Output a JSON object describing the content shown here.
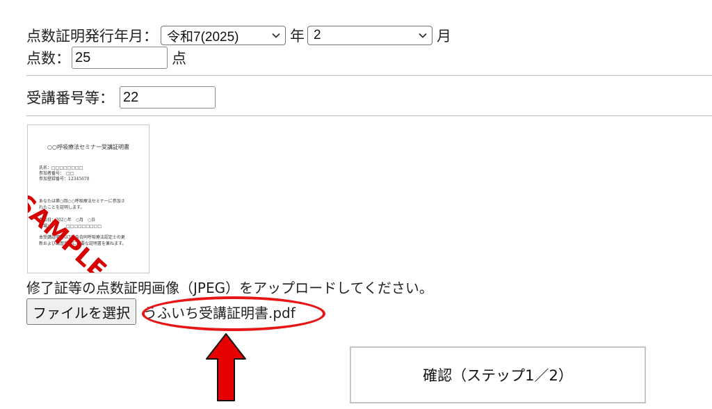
{
  "form": {
    "issue_date_label": "点数証明発行年月：",
    "year_selected": "令和7(2025)",
    "year_unit": "年",
    "month_selected": "2",
    "month_unit": "月",
    "score_label": "点数：",
    "score_value": "25",
    "score_unit": "点",
    "attendee_number_label": "受講番号等：",
    "attendee_number_value": "22"
  },
  "sample_image": {
    "title": "○○呼吸療法セミナー受講証明書",
    "lines": [
      "氏名：□□□□□□□□",
      "参加者番号：　□□",
      "参加登録番号：12345678",
      "あなたは第○回○○呼吸療法セミナーに参加さ",
      "れたことを証明します。",
      "参加日：202○年　○月　○日",
      "会場：　　　　□□□□□□□□□",
      "本受講証明書は3学会合同呼吸療法認定士の更",
      "新および講習受講に必要な証明書を兼ねます。"
    ],
    "watermark": "SAMPLE",
    "watermark_color": "#d60000"
  },
  "upload": {
    "instruction": "修了証等の点数証明画像（JPEG）をアップロードしてください。",
    "choose_file_label": "ファイルを選択",
    "selected_file_name": "うふいち受講証明書.pdf"
  },
  "annotations": {
    "highlight_color": "#e81515",
    "arrow_color": "#e60000"
  },
  "confirm_button_label": "確認（ステップ1／2）"
}
